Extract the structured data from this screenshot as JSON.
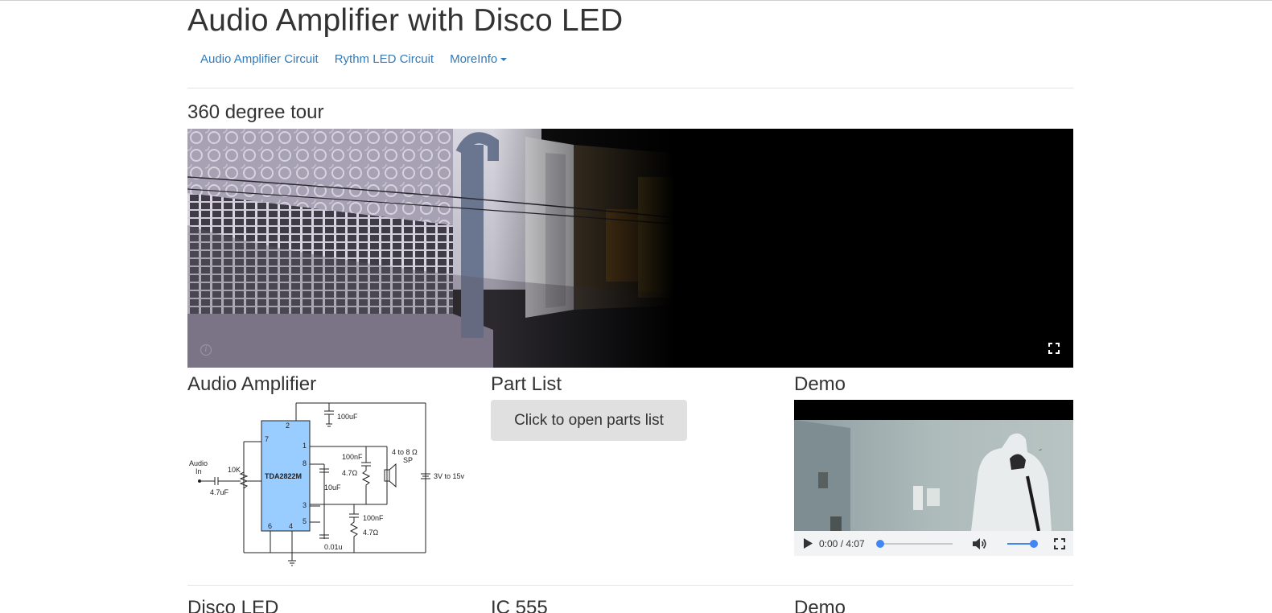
{
  "page": {
    "title": "Audio Amplifier with Disco LED"
  },
  "nav": {
    "items": [
      {
        "label": "Audio Amplifier Circuit"
      },
      {
        "label": "Rythm LED Circuit"
      },
      {
        "label": "MoreInfo",
        "dropdown": true
      }
    ]
  },
  "tour": {
    "heading": "360 degree tour",
    "info_icon": "info-icon",
    "fullscreen_icon": "fullscreen-icon"
  },
  "amplifier": {
    "heading": "Audio Amplifier",
    "schematic_labels": {
      "chip": "TDA2822M",
      "audio_in_1": "Audio",
      "audio_in_2": "In",
      "pot": "10K",
      "cap_in": "4.7uF",
      "cap_top": "100uF",
      "cap_10": "10uF",
      "cap_100n_a": "100nF",
      "res_a": "4.7Ω",
      "speaker_1": "4 to 8 Ω",
      "speaker_2": "SP",
      "supply": "3V to 15v",
      "cap_100n_b": "100nF",
      "res_b": "4.7Ω",
      "cap_001": "0.01u",
      "pin_2": "2",
      "pin_7": "7",
      "pin_1": "1",
      "pin_8": "8",
      "pin_3": "3",
      "pin_5": "5",
      "pin_6": "6",
      "pin_4": "4"
    }
  },
  "parts": {
    "heading": "Part List",
    "button_label": "Click to open parts list"
  },
  "demo": {
    "heading": "Demo",
    "time": "0:00 / 4:07",
    "progress": 0.0,
    "volume": 1.0,
    "play_icon": "play-icon",
    "volume_icon": "volume-icon",
    "fullscreen_icon": "fullscreen-icon"
  },
  "next_row": {
    "headings": [
      "Disco LED",
      "IC 555",
      "Demo"
    ]
  },
  "colors": {
    "link": "#337ab7",
    "text": "#333333",
    "button_bg": "#e0e0e0",
    "slider_accent": "#4285f4",
    "chip_fill": "#99ccff"
  }
}
